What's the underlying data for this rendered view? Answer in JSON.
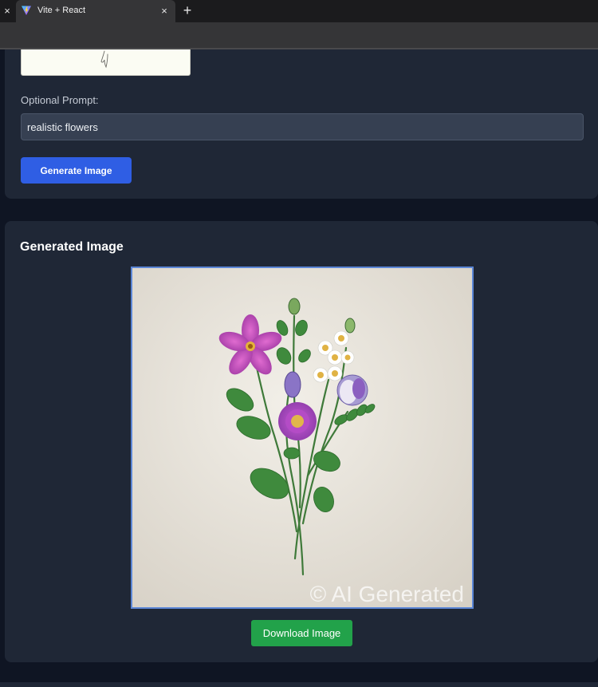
{
  "browser": {
    "tab_title": "Vite + React",
    "tab_close_symbol": "×",
    "prev_tab_close_symbol": "×",
    "new_tab_symbol": "+",
    "tab_icon": "vite-logo-icon"
  },
  "form": {
    "prompt_label": "Optional Prompt:",
    "prompt_value": "realistic flowers",
    "generate_button_label": "Generate Image"
  },
  "result": {
    "section_title": "Generated Image",
    "image_alt": "realistic flowers",
    "watermark": "© AI Generated",
    "download_button_label": "Download Image"
  },
  "colors": {
    "page_background": "#0f1523",
    "card_background": "#1f2736",
    "input_background": "#364052",
    "primary_button": "#2f5ee4",
    "download_button": "#22a24a",
    "image_border": "#5b86d6"
  }
}
